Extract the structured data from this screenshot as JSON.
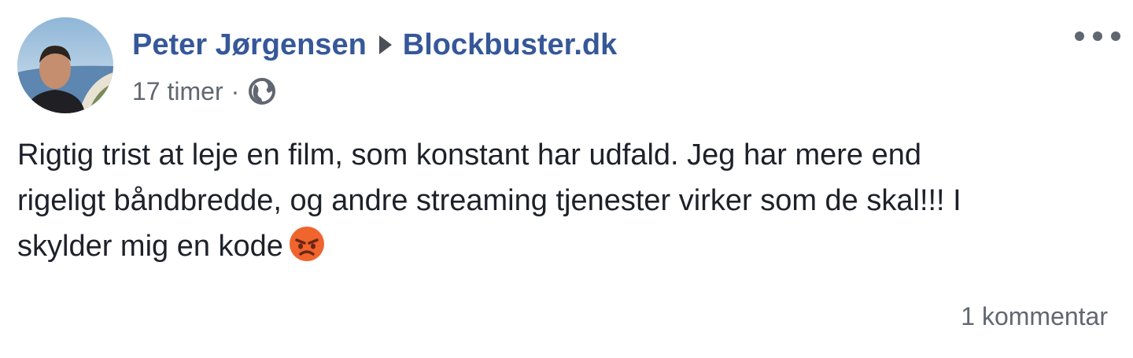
{
  "post": {
    "author": "Peter Jørgensen",
    "page": "Blockbuster.dk",
    "timestamp": "17 timer",
    "separator": "·",
    "privacy_icon": "globe-icon",
    "more_icon": "more-options-icon",
    "text_lines": [
      "Rigtig trist at leje en film, som konstant har udfald. Jeg har mere end",
      "rigeligt båndbredde, og andre streaming tjenester virker som de skal!!! I",
      "skylder mig en kode"
    ],
    "emoji": "angry-face-emoji",
    "comments": "1 kommentar"
  },
  "colors": {
    "link": "#365899",
    "text": "#1d2129",
    "muted": "#616770",
    "emoji": "#f0642e"
  }
}
